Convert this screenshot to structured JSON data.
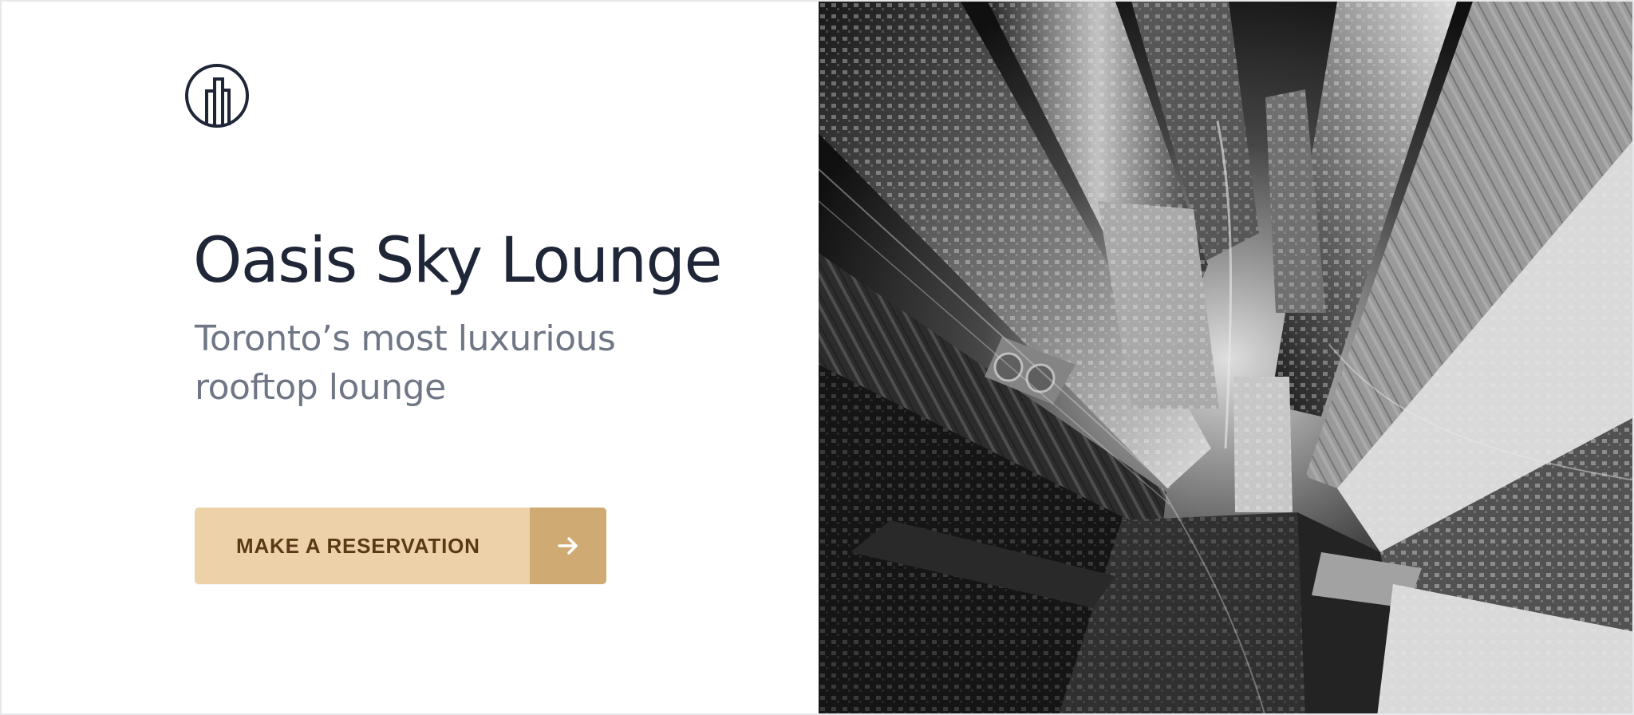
{
  "hero": {
    "title": "Oasis Sky Lounge",
    "subtitle": "Toronto’s most luxurious rooftop lounge",
    "cta": {
      "label": "MAKE A RESERVATION",
      "icon": "arrow-right-icon"
    }
  },
  "brand": {
    "logo_icon": "building-logo-icon",
    "accent": "#edd2a9",
    "accent_dark": "#d0aa73",
    "text": "#1f2637",
    "muted": "#6f7685"
  },
  "image": {
    "subject": "aerial-city-skyscrapers-photo",
    "tone": "grayscale"
  }
}
